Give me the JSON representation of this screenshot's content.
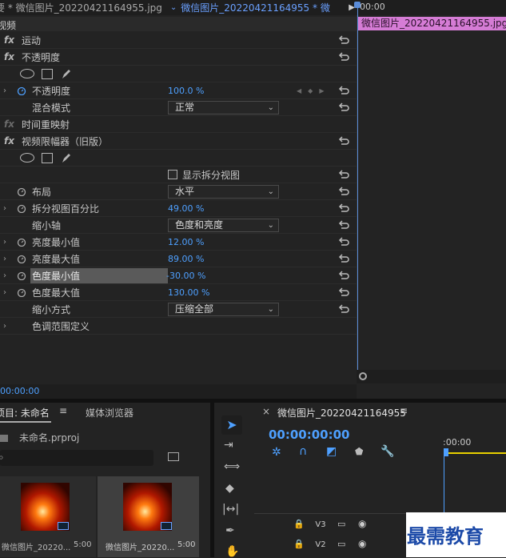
{
  "tabs": {
    "left": "要 * 微信图片_20220421164955.jpg",
    "arrow": "⌄",
    "right": "微信图片_20220421164955 * 微"
  },
  "effects": {
    "section": "视频",
    "motion": "运动",
    "opacity": "不透明度",
    "opacity_value": "不透明度",
    "opacity_pct": "100.0 %",
    "blend_mode": "混合模式",
    "blend_value": "正常",
    "time_remap": "时间重映射",
    "limiter": "视频限幅器（旧版）",
    "show_split": "显示拆分视图",
    "layout": "布局",
    "layout_value": "水平",
    "split_pct": "拆分视图百分比",
    "split_pct_value": "49.00 %",
    "reduce_axis": "缩小轴",
    "reduce_axis_value": "色度和亮度",
    "luma_min": "亮度最小值",
    "luma_min_value": "12.00 %",
    "luma_max": "亮度最大值",
    "luma_max_value": "89.00 %",
    "chroma_min": "色度最小值",
    "chroma_min_value": "-30.00 %",
    "chroma_max": "色度最大值",
    "chroma_max_value": "130.00 %",
    "reduce_method": "缩小方式",
    "reduce_method_value": "压缩全部",
    "tone_range": "色调范围定义",
    "timecode": "00:00:00"
  },
  "timeline_mini": {
    "ruler": "00:00",
    "clip": "微信图片_20220421164955.jpg"
  },
  "project": {
    "tab": "项目: 未命名",
    "tab2": "媒体浏览器",
    "file": "未命名.prproj",
    "items": [
      {
        "name": "微信图片_20220...",
        "dur": "5:00"
      },
      {
        "name": "微信图片_20220...",
        "dur": "5:00"
      }
    ]
  },
  "sequence": {
    "title": "微信图片_20220421164955",
    "timecode": "00:00:00:00",
    "ruler": ":00:00",
    "tracks": [
      "V3",
      "V2"
    ]
  },
  "watermark": "最需教育",
  "colors": {
    "accent": "#4ea0ff",
    "clip": "#d57cd5"
  }
}
